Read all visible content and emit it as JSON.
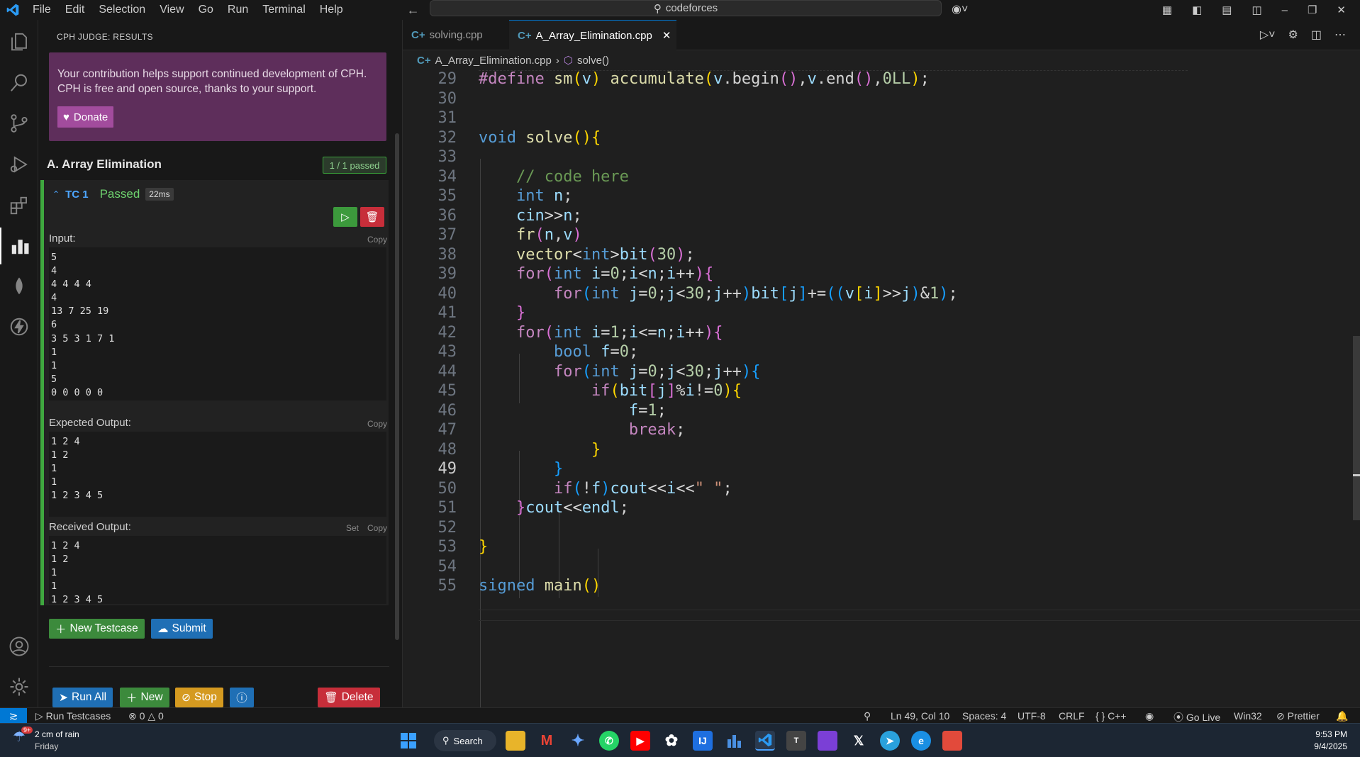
{
  "titlebar": {
    "menu": [
      "File",
      "Edit",
      "Selection",
      "View",
      "Go",
      "Run",
      "Terminal",
      "Help"
    ],
    "search": "codeforces"
  },
  "sidebar": {
    "title": "CPH JUDGE: RESULTS",
    "donate_text_1": "Your contribution helps support continued development of CPH.",
    "donate_text_2": "CPH is free and open source, thanks to your support.",
    "donate_label": "Donate",
    "problem_title": "A. Array Elimination",
    "passed_badge": "1 / 1 passed",
    "testcase": {
      "label": "TC 1",
      "status": "Passed",
      "time": "22ms",
      "input_label": "Input:",
      "input": "5\n4\n4 4 4 4\n4\n13 7 25 19\n6\n3 5 3 1 7 1\n1\n1\n5\n0 0 0 0 0",
      "expected_label": "Expected Output:",
      "expected": "1 2 4\n1 2\n1\n1\n1 2 3 4 5",
      "received_label": "Received Output:",
      "received": "1 2 4\n1 2\n1\n1\n1 2 3 4 5",
      "copy": "Copy",
      "set": "Set"
    },
    "new_testcase": "New Testcase",
    "submit": "Submit",
    "run_all": "Run All",
    "new": "New",
    "stop": "Stop",
    "delete": "Delete"
  },
  "tabs": [
    {
      "label": "solving.cpp",
      "active": false
    },
    {
      "label": "A_Array_Elimination.cpp",
      "active": true
    }
  ],
  "breadcrumb": {
    "file": "A_Array_Elimination.cpp",
    "symbol": "solve()"
  },
  "editor": {
    "line_numbers": [
      "29",
      "30",
      "31",
      "32",
      "33",
      "34",
      "35",
      "36",
      "37",
      "38",
      "39",
      "40",
      "41",
      "42",
      "43",
      "44",
      "45",
      "46",
      "47",
      "48",
      "49",
      "50",
      "51",
      "52",
      "53",
      "54",
      "55"
    ],
    "current_line": "49"
  },
  "statusbar": {
    "run_testcases": "Run Testcases",
    "errors": "0",
    "warnings": "0",
    "position": "Ln 49, Col 10",
    "spaces": "Spaces: 4",
    "encoding": "UTF-8",
    "eol": "CRLF",
    "language": "C++",
    "go_live": "Go Live",
    "platform": "Win32",
    "prettier": "Prettier"
  },
  "taskbar": {
    "weather": "2 cm of rain",
    "day": "Friday",
    "search": "Search",
    "time": "9:53 PM",
    "date": "9/4/2025",
    "weather_badge": "9+"
  },
  "colors": {
    "accent": "#0078d4",
    "passed": "#3fa83f",
    "donate_bg": "#5e2e5b"
  }
}
